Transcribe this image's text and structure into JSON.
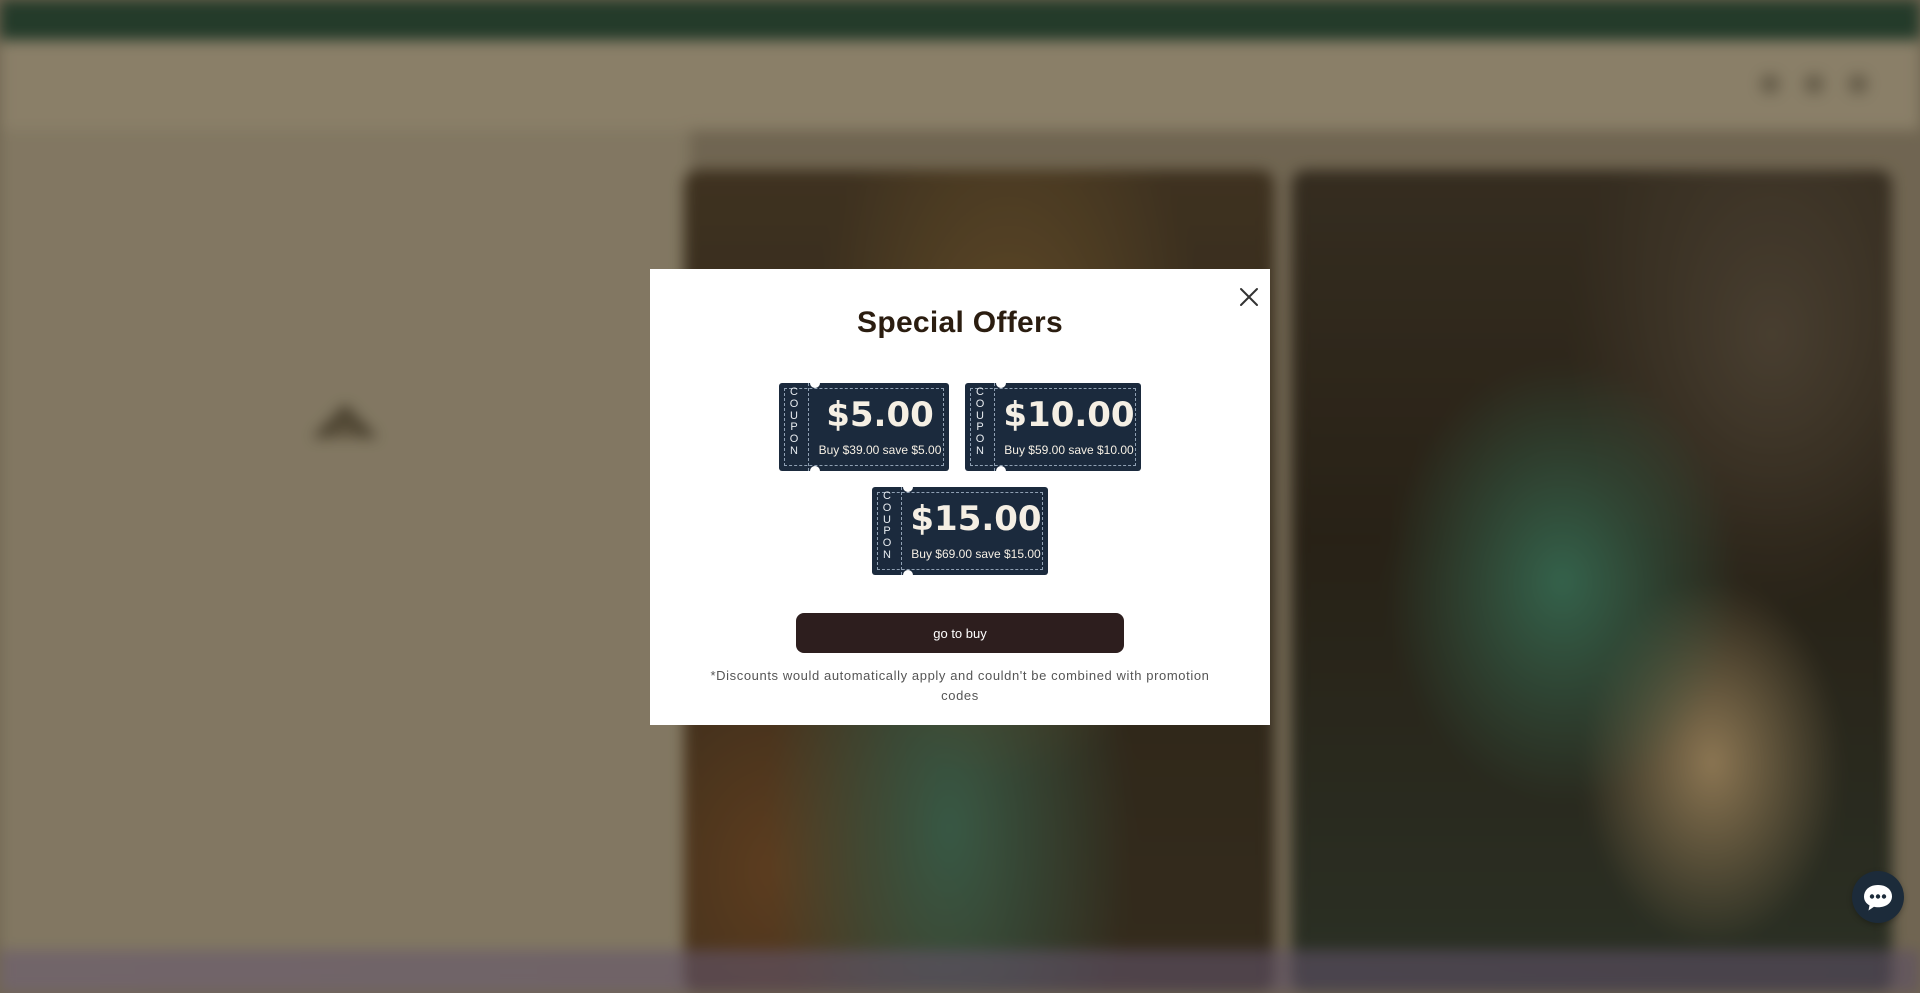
{
  "background": {
    "announcement": "",
    "logo": "",
    "nav_items": [
      "",
      "",
      "",
      "",
      "",
      "",
      ""
    ],
    "header_right": "",
    "breadcrumb": "",
    "hero_title": "",
    "hero_subtitle": "",
    "hero_subtitle_2": ""
  },
  "modal": {
    "title": "Special Offers",
    "coupons": [
      {
        "stub": "COUPON",
        "amount": "$5.00",
        "description": "Buy $39.00 save $5.00"
      },
      {
        "stub": "COUPON",
        "amount": "$10.00",
        "description": "Buy $59.00 save $10.00"
      },
      {
        "stub": "COUPON",
        "amount": "$15.00",
        "description": "Buy $69.00 save $15.00"
      }
    ],
    "button_label": "go to buy",
    "disclaimer": "*Discounts would automatically apply and couldn't be combined with promotion codes"
  },
  "icons": {
    "close": "close-icon",
    "chat": "chat-icon"
  },
  "colors": {
    "coupon_bg": "#1b2a3d",
    "button_bg": "#2d1e1e",
    "title_color": "#2b1d10",
    "announcement_bar": "#0f3a2c"
  }
}
